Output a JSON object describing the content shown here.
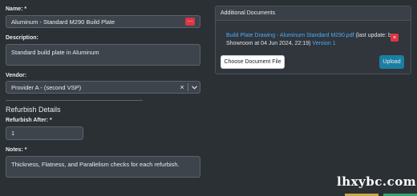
{
  "form": {
    "name_label": "Name: *",
    "name_value": "Aluminum - Standard M290 Build Plate",
    "name_button_icon": "⋯",
    "description_label": "Description:",
    "description_value": "Standard build plate in Aluminum",
    "vendor_label": "Vendor:",
    "vendor_value": "Provider A - (second VSP)",
    "vendor_clear_icon": "×",
    "vendor_chevron_icon": "⌄",
    "refurbish_section_title": "Refurbish Details",
    "refurbish_after_label": "Refurbish After: *",
    "refurbish_after_value": "1",
    "notes_label": "Notes: *",
    "notes_value": "Thickness, Flatness, and Parallelism checks for each refurbish."
  },
  "documents": {
    "header": "Additional Documents",
    "file_link": "Build Plate Drawing - Aluminum Standard M290.pdf",
    "update_text_1": " (last update: by",
    "update_text_2": "Showroom at 04 Jun 2024, 22:19) ",
    "version_link": "Version 1",
    "remove_icon": "×",
    "choose_button": "Choose Document File",
    "upload_button": "Upload"
  },
  "watermark": "lhxybc.com",
  "colors": {
    "background": "#2b3035",
    "field": "#3d444c",
    "danger": "#dc3545",
    "link": "#4dabf7",
    "upload": "#1b7fa3"
  }
}
